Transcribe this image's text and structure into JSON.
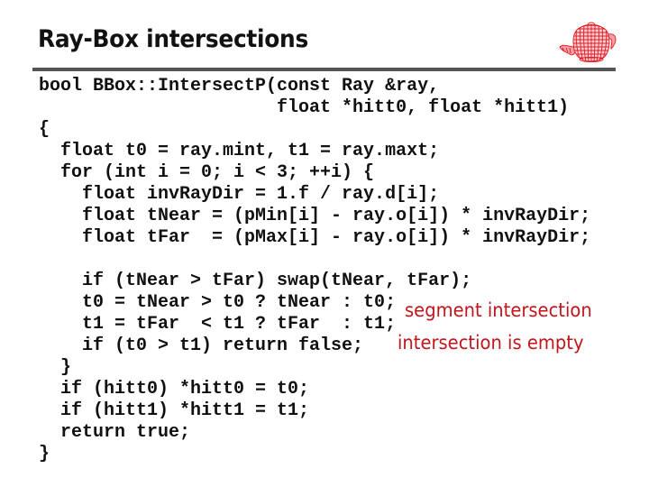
{
  "slide": {
    "title": "Ray-Box intersections",
    "logo_icon": "wireframe-teapot-icon",
    "accent_color": "#c0161c",
    "divider_color": "#555555"
  },
  "code": {
    "language": "C++",
    "lines": [
      "bool BBox::IntersectP(const Ray &ray,",
      "                      float *hitt0, float *hitt1)",
      "{",
      "  float t0 = ray.mint, t1 = ray.maxt;",
      "  for (int i = 0; i < 3; ++i) {",
      "    float invRayDir = 1.f / ray.d[i];",
      "    float tNear = (pMin[i] - ray.o[i]) * invRayDir;",
      "    float tFar  = (pMax[i] - ray.o[i]) * invRayDir;",
      "",
      "    if (tNear > tFar) swap(tNear, tFar);",
      "    t0 = tNear > t0 ? tNear : t0;",
      "    t1 = tFar  < t1 ? tFar  : t1;",
      "    if (t0 > t1) return false;",
      "  }",
      "  if (hitt0) *hitt0 = t0;",
      "  if (hitt1) *hitt1 = t1;",
      "  return true;",
      "}"
    ]
  },
  "annotations": {
    "segment": "segment intersection",
    "empty": "intersection is empty"
  }
}
